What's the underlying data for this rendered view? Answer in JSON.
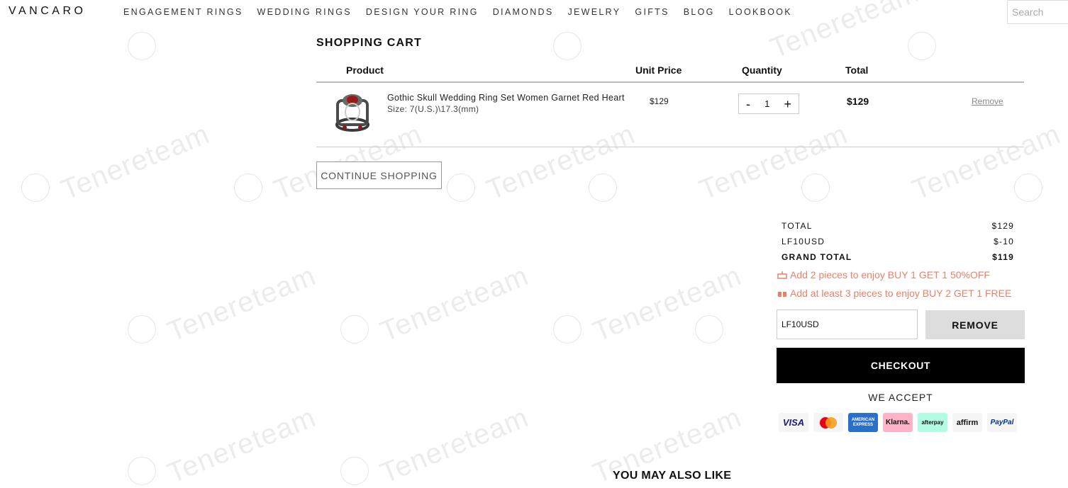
{
  "header": {
    "logo": "VANCARO",
    "nav": [
      "ENGAGEMENT RINGS",
      "WEDDING RINGS",
      "DESIGN YOUR RING",
      "DIAMONDS",
      "JEWELRY",
      "GIFTS",
      "BLOG",
      "LOOKBOOK"
    ],
    "search_placeholder": "Search"
  },
  "cart": {
    "title": "SHOPPING CART",
    "columns": {
      "product": "Product",
      "unit_price": "Unit Price",
      "quantity": "Quantity",
      "total": "Total"
    },
    "items": [
      {
        "name": "Gothic Skull Wedding Ring Set Women Garnet Red Heart",
        "size": "Size: 7(U.S.)\\17.3(mm)",
        "unit_price": "$129",
        "quantity": "1",
        "qty_minus": "-",
        "qty_plus": "+",
        "total": "$129",
        "remove": "Remove"
      }
    ],
    "continue_label": "CONTINUE SHOPPING"
  },
  "summary": {
    "total_label": "TOTAL",
    "total_value": "$129",
    "discount_label": "LF10USD",
    "discount_value": "$-10",
    "grand_label": "GRAND TOTAL",
    "grand_value": "$119",
    "promo1": "Add 2 pieces to enjoy BUY 1 GET 1 50%OFF",
    "promo2": "Add at least 3 pieces to enjoy BUY 2 GET 1 FREE",
    "coupon_value": "LF10USD",
    "coupon_button": "REMOVE",
    "checkout": "CHECKOUT",
    "we_accept": "WE ACCEPT",
    "payments": [
      "VISA",
      "Mastercard",
      "AMERICAN EXPRESS",
      "Klarna.",
      "afterpay",
      "affirm",
      "PayPal"
    ]
  },
  "watermark": "Tenereteam",
  "you_may_also_like": "YOU MAY ALSO LIKE",
  "colors": {
    "promo": "#e8816a",
    "checkout_bg": "#000000",
    "remove_btn_bg": "#dddddd"
  }
}
